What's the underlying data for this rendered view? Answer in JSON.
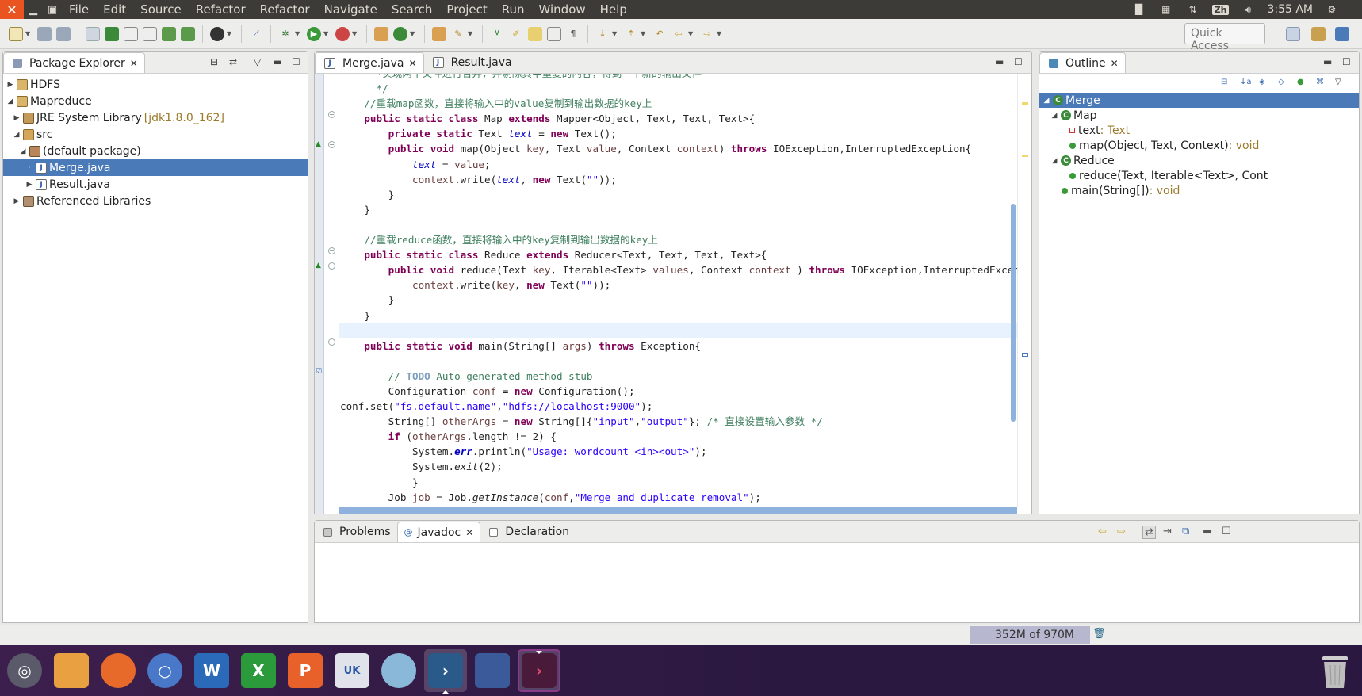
{
  "menubar": {
    "items": [
      "File",
      "Edit",
      "Source",
      "Refactor",
      "Refactor",
      "Navigate",
      "Search",
      "Project",
      "Run",
      "Window",
      "Help"
    ],
    "input_method": "Zh",
    "clock": "3:55 AM"
  },
  "toolbar": {
    "quick_access_placeholder": "Quick Access"
  },
  "package_explorer": {
    "tab_label": "Package Explorer",
    "tree": [
      {
        "label": "HDFS",
        "level": 0,
        "twisty": "collapsed",
        "icon": "project-icon"
      },
      {
        "label": "Mapreduce",
        "level": 0,
        "twisty": "expanded",
        "icon": "project-icon"
      },
      {
        "label": "JRE System Library",
        "suffix": "[jdk1.8.0_162]",
        "level": 1,
        "twisty": "collapsed",
        "icon": "library-icon"
      },
      {
        "label": "src",
        "level": 1,
        "twisty": "expanded",
        "icon": "source-folder-icon"
      },
      {
        "label": "(default package)",
        "level": 2,
        "twisty": "expanded",
        "icon": "package-icon"
      },
      {
        "label": "Merge.java",
        "level": 3,
        "twisty": "none",
        "icon": "java-file-icon",
        "selected": true
      },
      {
        "label": "Result.java",
        "level": 3,
        "twisty": "collapsed",
        "icon": "java-file-icon"
      },
      {
        "label": "Referenced Libraries",
        "level": 1,
        "twisty": "collapsed",
        "icon": "referenced-libraries-icon"
      }
    ]
  },
  "editor": {
    "tabs": [
      {
        "label": "Merge.java",
        "active": true
      },
      {
        "label": "Result.java",
        "active": false
      }
    ]
  },
  "outline": {
    "tab_label": "Outline",
    "items": [
      {
        "label": "Merge",
        "type": "",
        "kind": "class",
        "level": 0,
        "selected": true
      },
      {
        "label": "Map",
        "type": "",
        "kind": "class",
        "level": 1
      },
      {
        "label": "text",
        "type": " : Text",
        "kind": "field",
        "level": 2
      },
      {
        "label": "map(Object, Text, Context)",
        "type": " : void",
        "kind": "method",
        "level": 2
      },
      {
        "label": "Reduce",
        "type": "",
        "kind": "class",
        "level": 1
      },
      {
        "label": "reduce(Text, Iterable<Text>, Cont",
        "type": "",
        "kind": "method",
        "level": 2
      },
      {
        "label": "main(String[])",
        "type": " : void",
        "kind": "method",
        "level": 1
      }
    ]
  },
  "bottom_panel": {
    "tabs": [
      {
        "label": "Problems",
        "active": false
      },
      {
        "label": "Javadoc",
        "active": true
      },
      {
        "label": "Declaration",
        "active": false
      }
    ]
  },
  "status": {
    "heap": "352M of 970M"
  },
  "dock": {
    "apps": [
      "ubuntu-dash-icon",
      "files-icon",
      "firefox-icon",
      "chromium-icon",
      "writer-icon",
      "calc-icon",
      "impress-icon",
      "software-center-icon",
      "disk-icon",
      "vscode-icon",
      "eclipse-icon",
      "terminal-icon"
    ]
  }
}
